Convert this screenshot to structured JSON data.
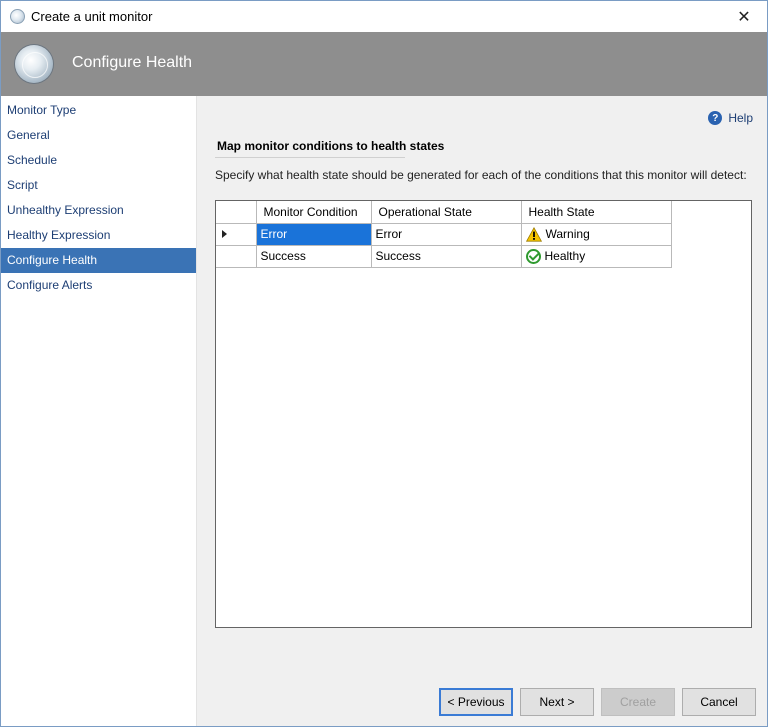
{
  "window": {
    "title": "Create a unit monitor",
    "close_glyph": "✕"
  },
  "banner": {
    "title": "Configure Health"
  },
  "nav": {
    "items": [
      {
        "label": "Monitor Type"
      },
      {
        "label": "General"
      },
      {
        "label": "Schedule"
      },
      {
        "label": "Script"
      },
      {
        "label": "Unhealthy Expression"
      },
      {
        "label": "Healthy Expression"
      },
      {
        "label": "Configure Health"
      },
      {
        "label": "Configure Alerts"
      }
    ],
    "active_index": 6
  },
  "help": {
    "icon_glyph": "?",
    "label": "Help"
  },
  "section": {
    "title": "Map monitor conditions to health states",
    "description": "Specify what health state should be generated for each of the conditions that this monitor will detect:"
  },
  "grid": {
    "columns": [
      "Monitor Condition",
      "Operational State",
      "Health State"
    ],
    "rows": [
      {
        "condition": "Error",
        "operational_state": "Error",
        "health_state": "Warning",
        "icon": "warning-icon"
      },
      {
        "condition": "Success",
        "operational_state": "Success",
        "health_state": "Healthy",
        "icon": "healthy-check-icon"
      }
    ]
  },
  "footer": {
    "previous_label": "< Previous",
    "next_label": "Next >",
    "create_label": "Create",
    "cancel_label": "Cancel"
  },
  "colors": {
    "banner": "#8e8e8e",
    "nav_active": "#3a73b5",
    "selection": "#1a73d9",
    "warning": "#f5c400",
    "healthy": "#2f9a2f"
  }
}
